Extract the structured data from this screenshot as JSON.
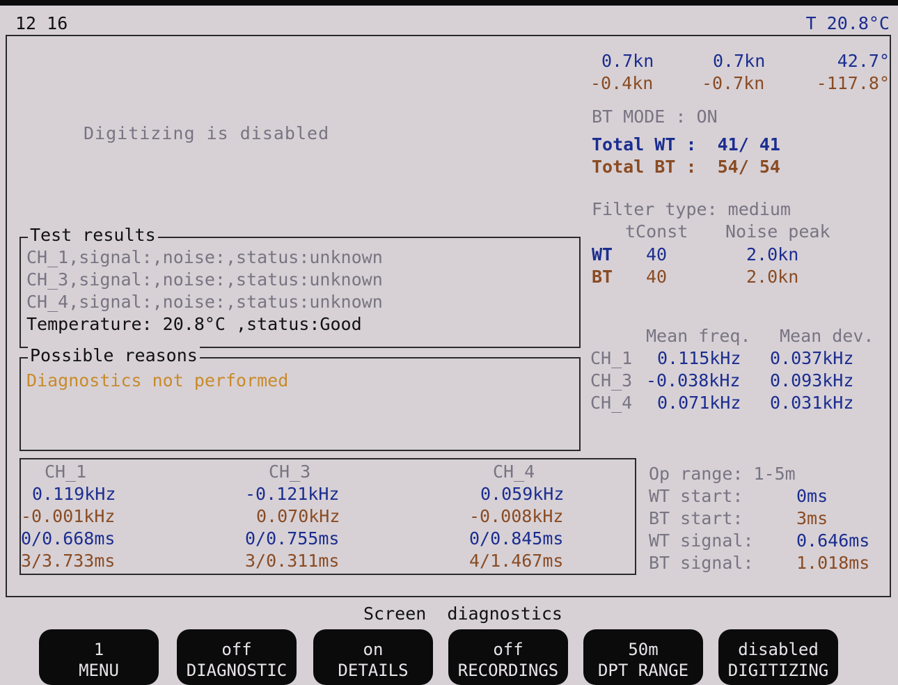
{
  "header": {
    "time": "12 16",
    "temperature": "T 20.8°C"
  },
  "status_message": "Digitizing is disabled",
  "speed": {
    "row1": [
      "0.7kn",
      "0.7kn",
      "42.7°"
    ],
    "row2": [
      "-0.4kn",
      "-0.7kn",
      "-117.8°"
    ]
  },
  "bt_mode": "BT MODE : ON",
  "totals": {
    "wt": "Total WT :  41/ 41",
    "bt": "Total BT :  54/ 54"
  },
  "filter": {
    "type": "Filter type: medium",
    "col_tconst": "tConst",
    "col_noise": "Noise peak",
    "rows": [
      {
        "label": "WT",
        "tconst": "40",
        "noise": "2.0kn"
      },
      {
        "label": "BT",
        "tconst": "40",
        "noise": "2.0kn"
      }
    ]
  },
  "mean_stats": {
    "col_freq": "Mean freq.",
    "col_dev": "Mean dev.",
    "rows": [
      {
        "ch": "CH_1",
        "freq": "0.115kHz",
        "dev": "0.037kHz"
      },
      {
        "ch": "CH_3",
        "freq": "-0.038kHz",
        "dev": "0.093kHz"
      },
      {
        "ch": "CH_4",
        "freq": "0.071kHz",
        "dev": "0.031kHz"
      }
    ]
  },
  "test_results": {
    "title": "Test results",
    "lines": [
      "CH_1,signal:,noise:,status:unknown",
      "CH_3,signal:,noise:,status:unknown",
      "CH_4,signal:,noise:,status:unknown"
    ],
    "temperature_line": "Temperature: 20.8°C ,status:Good"
  },
  "possible_reasons": {
    "title": "Possible reasons",
    "text": "Diagnostics not performed"
  },
  "channels": [
    {
      "name": "CH_1",
      "v1": "0.119kHz",
      "v2": "-0.001kHz",
      "v3": "0/0.668ms",
      "v4": "3/3.733ms"
    },
    {
      "name": "CH_3",
      "v1": "-0.121kHz",
      "v2": "0.070kHz",
      "v3": "0/0.755ms",
      "v4": "3/0.311ms"
    },
    {
      "name": "CH_4",
      "v1": "0.059kHz",
      "v2": "-0.008kHz",
      "v3": "0/0.845ms",
      "v4": "4/1.467ms"
    }
  ],
  "op_info": {
    "range": "Op range: 1-5m",
    "rows": [
      {
        "label": "WT start:",
        "value": "0ms"
      },
      {
        "label": "BT start:",
        "value": "3ms"
      },
      {
        "label": "WT signal:",
        "value": "0.646ms"
      },
      {
        "label": "BT signal:",
        "value": "1.018ms"
      }
    ]
  },
  "screen_title": "Screen  diagnostics",
  "softkeys": [
    {
      "top": "1",
      "bottom": "MENU"
    },
    {
      "top": "off",
      "bottom": "DIAGNOSTIC"
    },
    {
      "top": "on",
      "bottom": "DETAILS"
    },
    {
      "top": "off",
      "bottom": "RECORDINGS"
    },
    {
      "top": "50m",
      "bottom": "DPT RANGE"
    },
    {
      "top": "disabled",
      "bottom": "DIGITIZING"
    }
  ]
}
